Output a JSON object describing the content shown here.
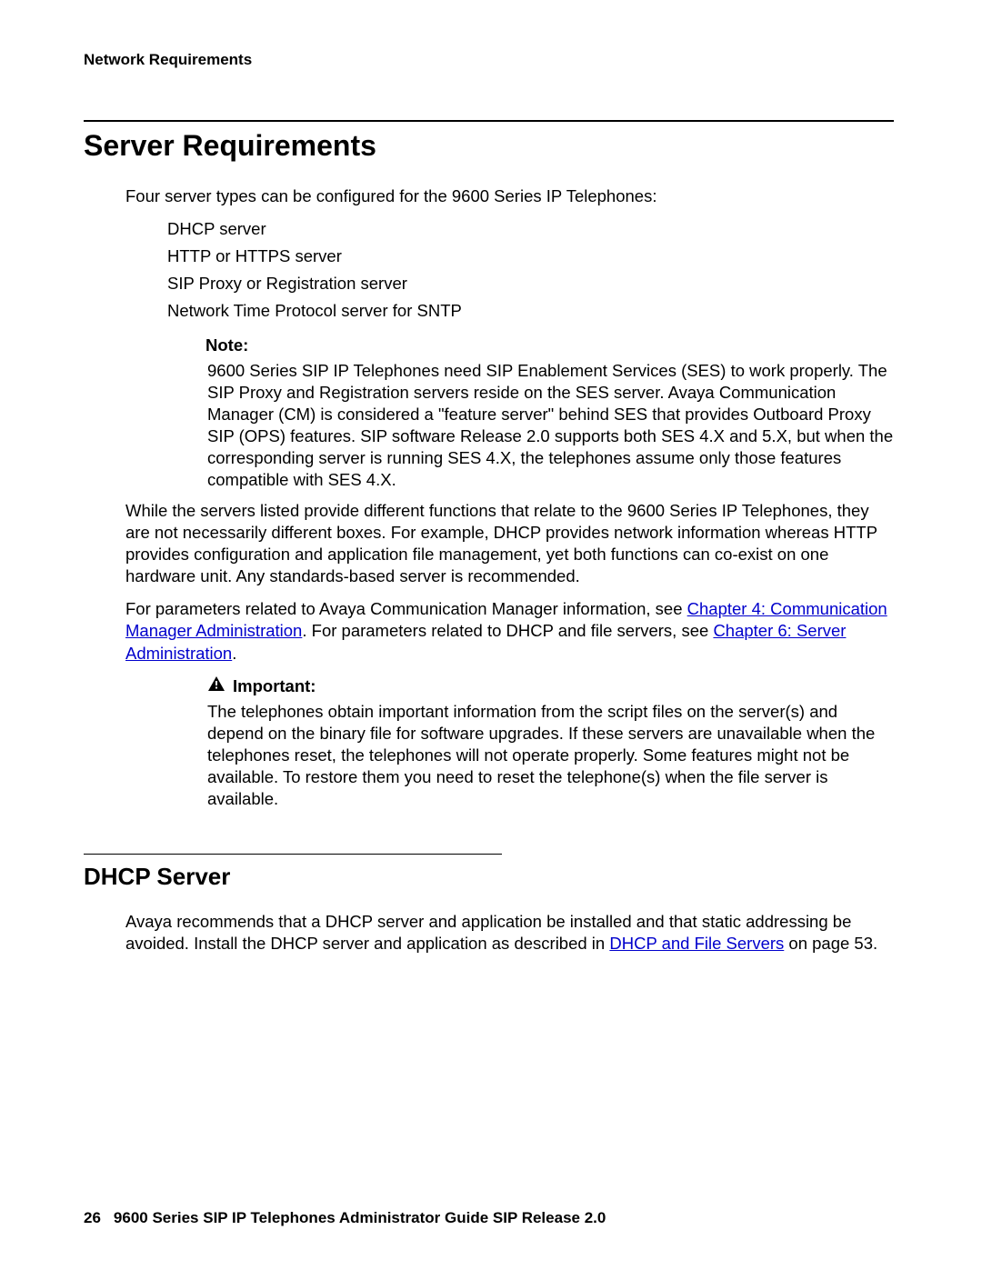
{
  "runningHead": "Network Requirements",
  "h1": "Server Requirements",
  "intro": "Four server types can be configured for the 9600 Series IP Telephones:",
  "serverTypes": [
    "DHCP server",
    "HTTP or HTTPS server",
    "SIP Proxy or Registration server",
    "Network Time Protocol server for SNTP"
  ],
  "noteLabel": "Note:",
  "noteBody": "9600 Series SIP IP Telephones need SIP Enablement Services (SES) to work properly. The SIP Proxy and Registration servers reside on the SES server. Avaya Communication Manager (CM) is considered a \"feature server\" behind SES that provides Outboard Proxy SIP (OPS) features. SIP software Release 2.0 supports both SES 4.X and 5.X, but when the corresponding server is running SES 4.X, the telephones assume only those features compatible with SES 4.X.",
  "para2": "While the servers listed provide different functions that relate to the 9600 Series IP Telephones, they are not necessarily different boxes. For example, DHCP provides network information whereas HTTP provides configuration and application file management, yet both functions can co-exist on one hardware unit. Any standards-based server is recommended.",
  "para3_pre": "For parameters related to Avaya Communication Manager information, see ",
  "link1": "Chapter 4: Communication Manager Administration",
  "para3_mid": ". For parameters related to DHCP and file servers, see ",
  "link2": "Chapter 6: Server Administration",
  "para3_post": ".",
  "importantLabel": "Important:",
  "importantBody": "The telephones obtain important information from the script files on the server(s) and depend on the binary file for software upgrades. If these servers are unavailable when the telephones reset, the telephones will not operate properly. Some features might not be available. To restore them you need to reset the telephone(s) when the file server is available.",
  "h2": "DHCP Server",
  "dhcp_pre": "Avaya recommends that a DHCP server and application be installed and that static addressing be avoided. Install the DHCP server and application as described in ",
  "link3": "DHCP and File Servers",
  "dhcp_post": " on page 53.",
  "footer": {
    "page": "26",
    "title": "9600 Series SIP IP Telephones Administrator Guide SIP Release 2.0"
  }
}
